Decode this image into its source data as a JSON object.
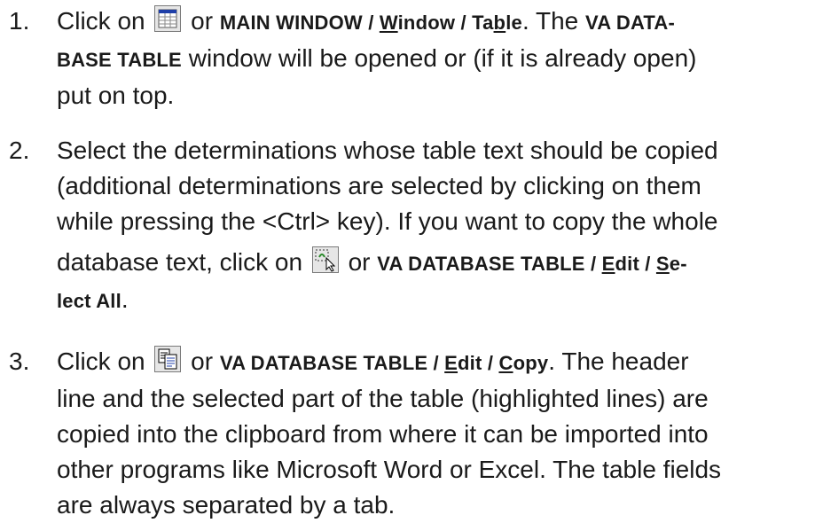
{
  "steps": [
    {
      "number": "1.",
      "p1": "Click on",
      "icon": "table-window-icon",
      "p2": "or",
      "menu_path": {
        "a": "MAIN WINDOW / ",
        "b_u": "W",
        "b_rest": "indow / Ta",
        "c_u": "b",
        "c_rest": "le"
      },
      "p3": ". The",
      "window_name_1": "VA DATA-",
      "window_name_2": "BASE TABLE",
      "line2_rest": "window will be opened or (if it is already open)",
      "line3": "put on top."
    },
    {
      "number": "2.",
      "line1": "Select the determinations whose table text should be copied",
      "line2": "(additional determinations are selected by clicking on them",
      "line3": "while pressing the <Ctrl> key). If you want to copy the whole",
      "p1": "database text, click on",
      "icon": "select-all-icon",
      "p2": "or",
      "menu_path": {
        "a": "VA DATABASE TABLE / ",
        "e_u": "E",
        "e_rest": "dit / ",
        "s_u": "S",
        "s_rest": "e-",
        "s_line2": "lect All"
      },
      "end": "."
    },
    {
      "number": "3.",
      "p1": "Click on",
      "icon": "copy-icon",
      "p2": "or",
      "menu_path": {
        "a": "VA DATABASE TABLE / ",
        "e_u": "E",
        "e_rest": "dit / ",
        "c_u": "C",
        "c_rest": "opy"
      },
      "p3": ". The header",
      "line2": "line and the selected part of the table (highlighted lines) are",
      "line3": "copied into the clipboard from where it can be imported into",
      "line4": "other programs like Microsoft Word or Excel. The table fields",
      "line5": "are always separated by a tab."
    }
  ]
}
